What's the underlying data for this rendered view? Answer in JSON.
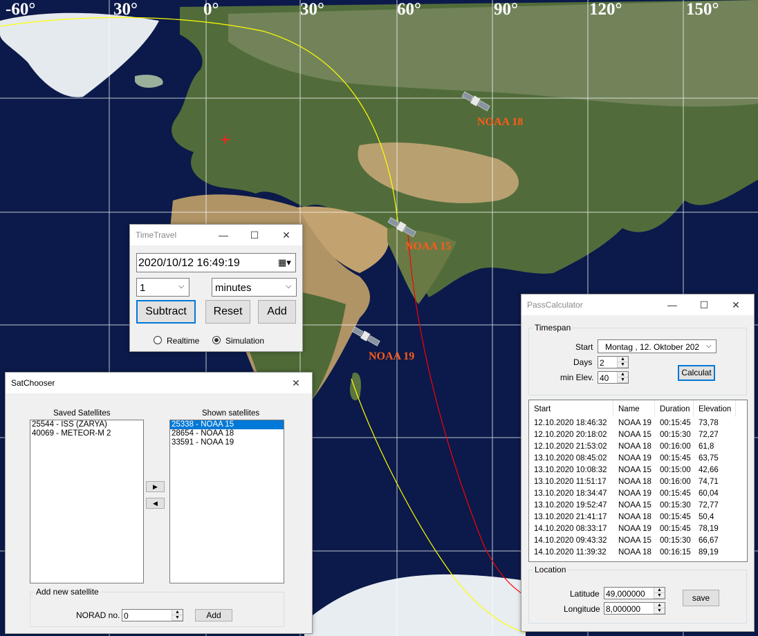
{
  "map": {
    "longitude_labels": [
      "-60°",
      "30°",
      "0°",
      "30°",
      "60°",
      "90°",
      "120°",
      "150°"
    ],
    "satellites": [
      {
        "name": "NOAA 18"
      },
      {
        "name": "NOAA 15"
      },
      {
        "name": "NOAA 19"
      }
    ],
    "colors": {
      "ocean": "#0b1a4a",
      "land": "#4d6a37",
      "desert": "#b69b6b",
      "ice": "#e8eef2",
      "grid": "#ffffff",
      "track_yellow": "#ffff00",
      "track_red": "#ff0000",
      "sat_label": "#ff5a1a"
    }
  },
  "timetravel": {
    "title": "TimeTravel",
    "datetime": "2020/10/12 16:49:19",
    "amount": "1",
    "unit": "minutes",
    "subtract_label": "Subtract",
    "reset_label": "Reset",
    "add_label": "Add",
    "realtime_label": "Realtime",
    "simulation_label": "Simulation",
    "mode": "Simulation"
  },
  "satchooser": {
    "title": "SatChooser",
    "saved_label": "Saved Satellites",
    "shown_label": "Shown satellites",
    "saved": [
      "25544 - ISS (ZARYA)",
      "40069 - METEOR-M 2"
    ],
    "shown": [
      "25338 - NOAA 15",
      "28654 - NOAA 18",
      "33591 - NOAA 19"
    ],
    "selected_shown": "25338 - NOAA 15",
    "move_right_icon": "▶",
    "move_left_icon": "◀",
    "add_new_label": "Add new satellite",
    "norad_label": "NORAD no.",
    "norad_value": "0",
    "add_label": "Add"
  },
  "passcalc": {
    "title": "PassCalculator",
    "timespan_label": "Timespan",
    "start_label": "Start",
    "start_value": "Montag   , 12.  Oktober  202",
    "days_label": "Days",
    "days_value": "2",
    "minelev_label": "min Elev.",
    "minelev_value": "40",
    "calculate_label": "Calculat",
    "columns": [
      "Start",
      "Name",
      "Duration",
      "Elevation"
    ],
    "rows": [
      [
        "12.10.2020 18:46:32",
        "NOAA 19",
        "00:15:45",
        "73,78"
      ],
      [
        "12.10.2020 20:18:02",
        "NOAA 15",
        "00:15:30",
        "72,27"
      ],
      [
        "12.10.2020 21:53:02",
        "NOAA 18",
        "00:16:00",
        "61,8"
      ],
      [
        "13.10.2020 08:45:02",
        "NOAA 19",
        "00:15:45",
        "63,75"
      ],
      [
        "13.10.2020 10:08:32",
        "NOAA 15",
        "00:15:00",
        "42,66"
      ],
      [
        "13.10.2020 11:51:17",
        "NOAA 18",
        "00:16:00",
        "74,71"
      ],
      [
        "13.10.2020 18:34:47",
        "NOAA 19",
        "00:15:45",
        "60,04"
      ],
      [
        "13.10.2020 19:52:47",
        "NOAA 15",
        "00:15:30",
        "72,77"
      ],
      [
        "13.10.2020 21:41:17",
        "NOAA 18",
        "00:15:45",
        "50,4"
      ],
      [
        "14.10.2020 08:33:17",
        "NOAA 19",
        "00:15:45",
        "78,19"
      ],
      [
        "14.10.2020 09:43:32",
        "NOAA 15",
        "00:15:30",
        "66,67"
      ],
      [
        "14.10.2020 11:39:32",
        "NOAA 18",
        "00:16:15",
        "89,19"
      ]
    ],
    "location_label": "Location",
    "latitude_label": "Latitude",
    "latitude_value": "49,000000",
    "longitude_label": "Longitude",
    "longitude_value": "8,000000",
    "save_label": "save"
  }
}
